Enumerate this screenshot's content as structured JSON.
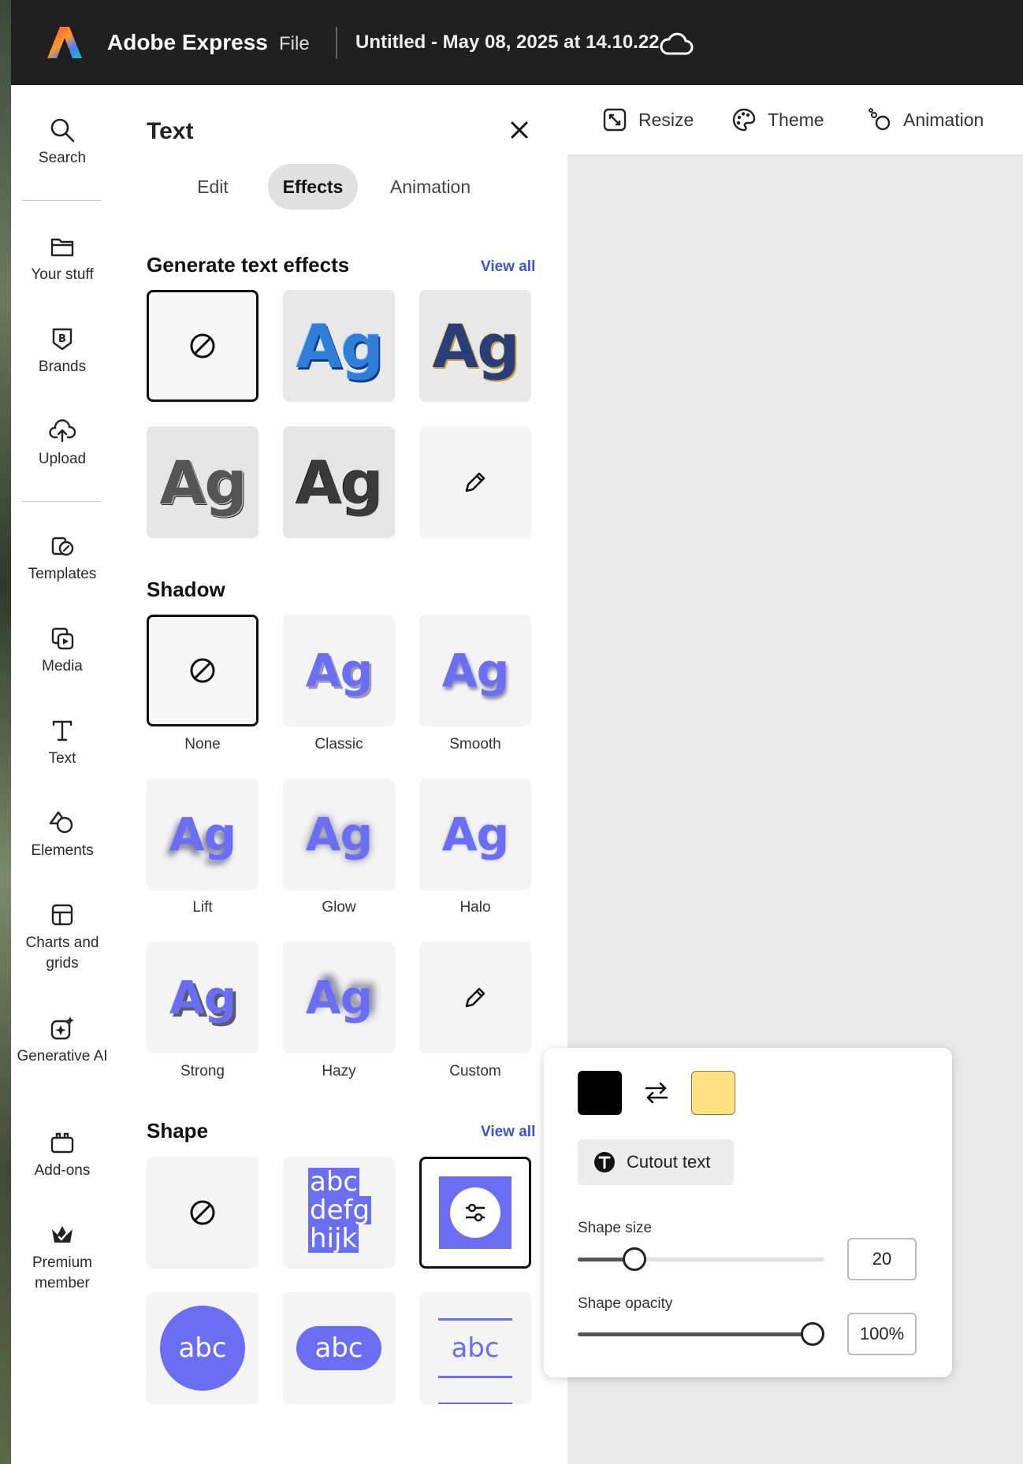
{
  "header": {
    "app_name": "Adobe Express",
    "file_menu": "File",
    "doc_title": "Untitled - May 08, 2025 at 14.10.22"
  },
  "rail": {
    "items": [
      {
        "label": "Search",
        "icon": "search-icon"
      },
      {
        "label": "Your stuff",
        "icon": "folder-icon"
      },
      {
        "label": "Brands",
        "icon": "brand-icon"
      },
      {
        "label": "Upload",
        "icon": "upload-cloud-icon"
      },
      {
        "label": "Templates",
        "icon": "templates-icon"
      },
      {
        "label": "Media",
        "icon": "media-icon"
      },
      {
        "label": "Text",
        "icon": "text-icon"
      },
      {
        "label": "Elements",
        "icon": "elements-icon"
      },
      {
        "label": "Charts and grids",
        "icon": "charts-grids-icon"
      },
      {
        "label": "Generative AI",
        "icon": "generative-ai-icon"
      },
      {
        "label": "Add-ons",
        "icon": "addons-icon"
      },
      {
        "label": "Premium member",
        "icon": "premium-crown-icon"
      }
    ]
  },
  "panel": {
    "title": "Text",
    "tabs": [
      "Edit",
      "Effects",
      "Animation"
    ],
    "active_tab": "Effects",
    "generate": {
      "heading": "Generate text effects",
      "view_all": "View all",
      "sample": "Ag"
    },
    "shadow": {
      "heading": "Shadow",
      "sample": "Ag",
      "options": [
        "None",
        "Classic",
        "Smooth",
        "Lift",
        "Glow",
        "Halo",
        "Strong",
        "Hazy",
        "Custom"
      ]
    },
    "shape": {
      "heading": "Shape",
      "view_all": "View all",
      "sample_block_1": "abc",
      "sample_block_2": "defg",
      "sample_block_3": "hijk",
      "sample_abc": "abc"
    }
  },
  "toolbar": {
    "resize": "Resize",
    "theme": "Theme",
    "animation": "Animation"
  },
  "popover": {
    "primary_color": "#000000",
    "secondary_color": "#FFE283",
    "cutout_label": "Cutout text",
    "shape_size_label": "Shape size",
    "shape_size_value": "20",
    "shape_size_fraction": 0.2,
    "shape_opacity_label": "Shape opacity",
    "shape_opacity_value": "100%",
    "shape_opacity_fraction": 1.0
  },
  "colors": {
    "accent": "#6A6EF2",
    "topbar": "#1F1F1F",
    "link": "#3B56C4"
  }
}
